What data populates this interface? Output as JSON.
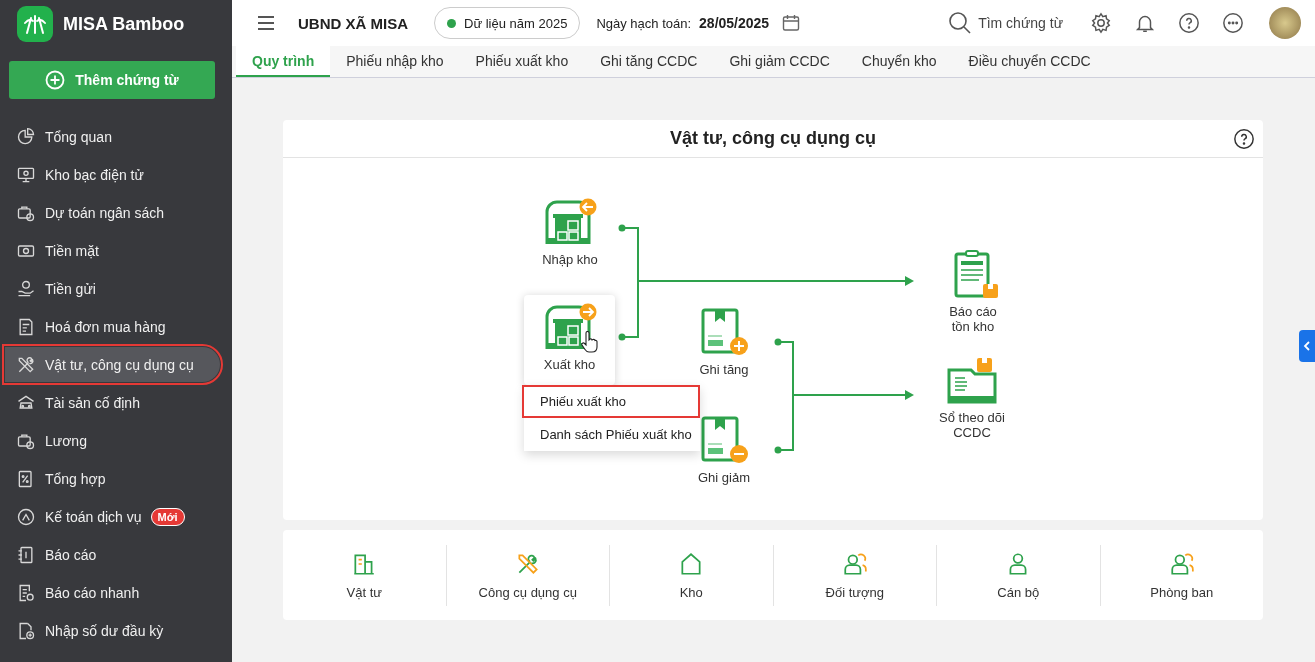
{
  "app": {
    "name": "MISA Bamboo"
  },
  "sidebar": {
    "add_button": "Thêm chứng từ",
    "items": [
      {
        "label": "Tổng quan",
        "selected": false,
        "highlighted": false
      },
      {
        "label": "Kho bạc điện tử",
        "selected": false,
        "highlighted": false
      },
      {
        "label": "Dự toán ngân sách",
        "selected": false,
        "highlighted": false
      },
      {
        "label": "Tiền mặt",
        "selected": false,
        "highlighted": false
      },
      {
        "label": "Tiền gửi",
        "selected": false,
        "highlighted": false
      },
      {
        "label": "Hoá đơn mua hàng",
        "selected": false,
        "highlighted": false
      },
      {
        "label": "Vật tư, công cụ dụng cụ",
        "selected": true,
        "highlighted": true
      },
      {
        "label": "Tài sản cố định",
        "selected": false,
        "highlighted": false
      },
      {
        "label": "Lương",
        "selected": false,
        "highlighted": false
      },
      {
        "label": "Tổng hợp",
        "selected": false,
        "highlighted": false
      },
      {
        "label": "Kế toán dịch vụ",
        "selected": false,
        "highlighted": false,
        "badge": "Mới"
      },
      {
        "label": "Báo cáo",
        "selected": false,
        "highlighted": false
      },
      {
        "label": "Báo cáo nhanh",
        "selected": false,
        "highlighted": false
      },
      {
        "label": "Nhập số dư đầu kỳ",
        "selected": false,
        "highlighted": false
      }
    ]
  },
  "topbar": {
    "org": "UBND XÃ MISA",
    "data_year": "Dữ liệu năm 2025",
    "date_label": "Ngày hạch toán:",
    "date": "28/05/2025",
    "search": "Tìm chứng từ"
  },
  "tabs": [
    {
      "label": "Quy trình",
      "selected": true
    },
    {
      "label": "Phiếu nhập kho",
      "selected": false
    },
    {
      "label": "Phiếu xuất kho",
      "selected": false
    },
    {
      "label": "Ghi tăng CCDC",
      "selected": false
    },
    {
      "label": "Ghi giảm CCDC",
      "selected": false
    },
    {
      "label": "Chuyển kho",
      "selected": false
    },
    {
      "label": "Điều chuyển CCDC",
      "selected": false
    }
  ],
  "process": {
    "title": "Vật tư, công cụ dụng cụ",
    "nodes": [
      {
        "label": "Nhập kho",
        "kind": "warehouse-in",
        "hovered": false
      },
      {
        "label": "Xuất kho",
        "kind": "warehouse-out",
        "hovered": true
      },
      {
        "label": "Ghi tăng",
        "kind": "box-plus",
        "hovered": false
      },
      {
        "label": "Ghi giảm",
        "kind": "box-minus",
        "hovered": false
      },
      {
        "label": "Báo cáo\ntồn kho",
        "kind": "report",
        "hovered": false
      },
      {
        "label": "Sổ theo dõi\nCCDC",
        "kind": "book",
        "hovered": false
      }
    ],
    "menu": [
      {
        "label": "Phiếu xuất kho",
        "highlighted": true
      },
      {
        "label": "Danh sách Phiếu xuất kho",
        "highlighted": false
      }
    ]
  },
  "shortcuts": [
    {
      "label": "Vật tư"
    },
    {
      "label": "Công cụ dụng cụ"
    },
    {
      "label": "Kho"
    },
    {
      "label": "Đối tượng"
    },
    {
      "label": "Cán bộ"
    },
    {
      "label": "Phòng ban"
    }
  ]
}
